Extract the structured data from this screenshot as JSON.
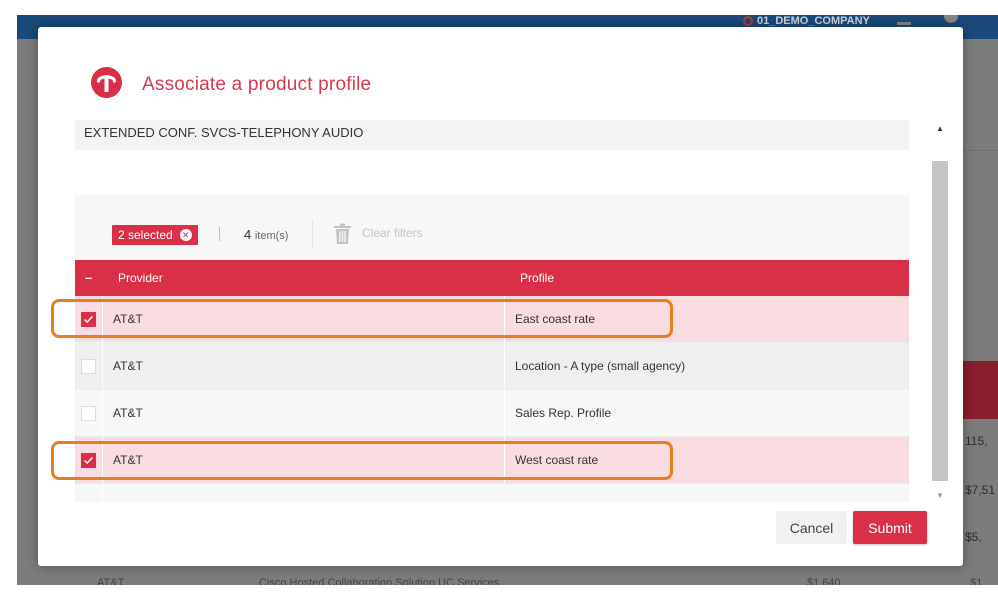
{
  "background": {
    "company": "01_DEMO_COMPANY",
    "numbers": [
      "115,",
      "$7,51",
      "$5,",
      "$1"
    ],
    "row": {
      "provider": "AT&T",
      "product": "Cisco Hosted Collaboration Solution UC Services",
      "price": "$1,640"
    }
  },
  "modal": {
    "title": "Associate a product profile",
    "product_name": "EXTENDED CONF. SVCS-TELEPHONY AUDIO",
    "filter": {
      "selected_label": "2 selected",
      "item_count": "4",
      "item_label": "item(s)",
      "clear_filters": "Clear filters"
    },
    "grid": {
      "columns": {
        "provider": "Provider",
        "profile": "Profile"
      },
      "rows": [
        {
          "provider": "AT&T",
          "profile": "East coast rate",
          "checked": true
        },
        {
          "provider": "AT&T",
          "profile": "Location - A type (small agency)",
          "checked": false
        },
        {
          "provider": "AT&T",
          "profile": "Sales Rep. Profile",
          "checked": false
        },
        {
          "provider": "AT&T",
          "profile": "West coast rate",
          "checked": true
        }
      ]
    },
    "buttons": {
      "cancel": "Cancel",
      "submit": "Submit"
    }
  },
  "colors": {
    "accent": "#d92f47",
    "highlight": "#e67e22",
    "selected_row": "#f9dce0"
  }
}
